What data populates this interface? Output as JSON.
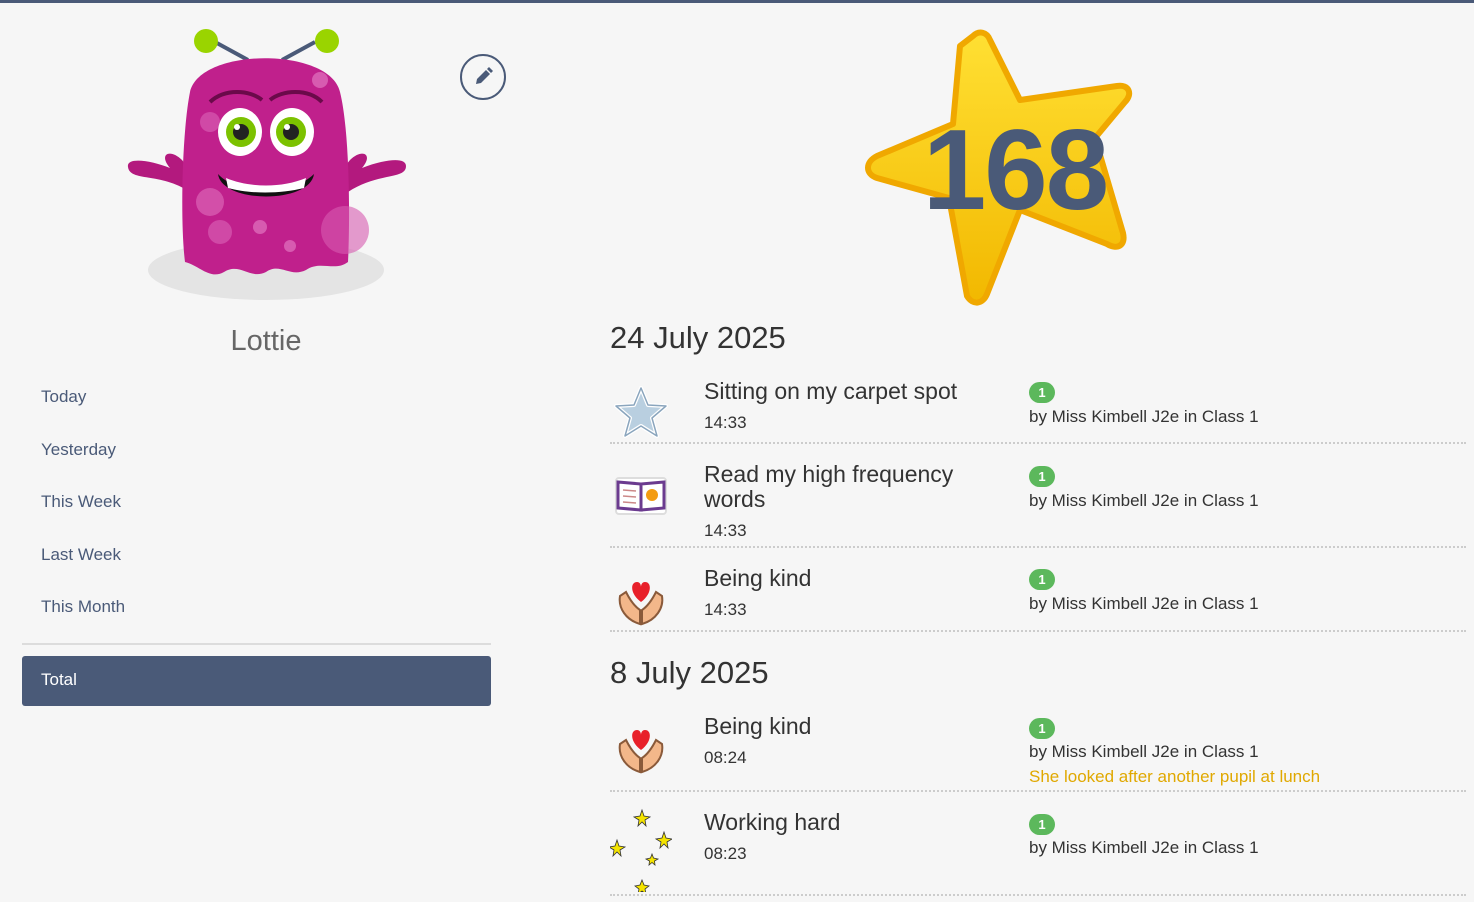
{
  "pupil": {
    "name": "Lottie"
  },
  "points": "168",
  "nav": {
    "items": [
      "Today",
      "Yesterday",
      "This Week",
      "Last Week",
      "This Month"
    ],
    "total": "Total"
  },
  "icons": {
    "edit": "pencil-icon",
    "avatar": "pink-monster-avatar",
    "star": "gold-star-icon"
  },
  "colors": {
    "accent": "#4a5a78",
    "badge": "#5cb85c",
    "note": "#e0a800",
    "star": "#f7c600"
  },
  "days": [
    {
      "date": "24 July 2025",
      "entries": [
        {
          "title": "Sitting on my carpet spot",
          "time": "14:33",
          "points": "1",
          "by": "by Miss Kimbell J2e in Class 1",
          "icon": "blue-star-icon"
        },
        {
          "title": "Read my high frequency words",
          "time": "14:33",
          "points": "1",
          "by": "by Miss Kimbell J2e in Class 1",
          "icon": "book-icon"
        },
        {
          "title": "Being kind",
          "time": "14:33",
          "points": "1",
          "by": "by Miss Kimbell J2e in Class 1",
          "icon": "heart-hands-icon"
        }
      ]
    },
    {
      "date": "8 July 2025",
      "entries": [
        {
          "title": "Being kind",
          "time": "08:24",
          "points": "1",
          "by": "by Miss Kimbell J2e in Class 1",
          "note": "She looked after another pupil at lunch",
          "icon": "heart-hands-icon"
        },
        {
          "title": "Working hard",
          "time": "08:23",
          "points": "1",
          "by": "by Miss Kimbell J2e in Class 1",
          "icon": "sparkle-stars-icon"
        }
      ]
    }
  ]
}
